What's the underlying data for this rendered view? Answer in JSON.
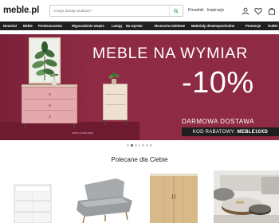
{
  "header": {
    "logo_text": "meble",
    "logo_dot": ".",
    "logo_tld": "pl",
    "search_placeholder": "Czego dzisiaj szukasz?",
    "links": [
      "Poradnik",
      "Inspiracje"
    ]
  },
  "nav": {
    "items": [
      "Nowości",
      "Meble",
      "Pomieszczenia",
      "Wyposażenie wnętrz",
      "Lampy",
      "Na wymiar",
      "Akcesoria meblowe",
      "Materiały drewnopochodne",
      "Promocje",
      "Outlet"
    ]
  },
  "hero": {
    "title": "MEBLE NA WYMIAR",
    "discount": "-10%",
    "subtitle": "DARMOWA DOSTAWA",
    "coupon_label": "KOD RABATOWY:",
    "coupon_code": "MEBLE10XD",
    "watermark": "meble.pl aranżacja",
    "slides_total": 7,
    "slide_active": 1
  },
  "recommended": {
    "title": "Polecane dla Ciebie"
  },
  "colors": {
    "hero_bg": "#8e2a43",
    "nav_bg": "#1f1f1f",
    "accent_green": "#2e9d3e"
  }
}
